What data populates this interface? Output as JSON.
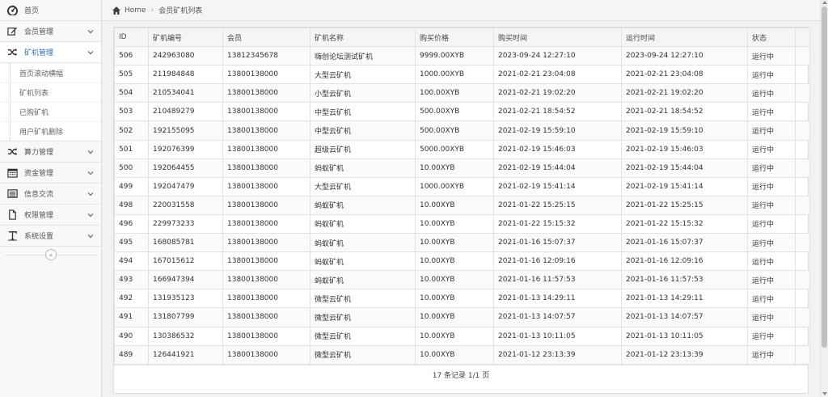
{
  "sidebar": {
    "items": [
      {
        "label": "首页",
        "icon": "dashboard-icon",
        "has_chevron": false
      },
      {
        "label": "会员管理",
        "icon": "edit-icon",
        "has_chevron": true
      },
      {
        "label": "矿机管理",
        "icon": "shuffle-icon",
        "has_chevron": true,
        "active": true,
        "sub": [
          {
            "label": "首页滚动横幅"
          },
          {
            "label": "矿机列表"
          },
          {
            "label": "已购矿机"
          },
          {
            "label": "用户矿机删除"
          }
        ]
      },
      {
        "label": "算力管理",
        "icon": "shuffle-icon",
        "has_chevron": true
      },
      {
        "label": "资金管理",
        "icon": "calendar-icon",
        "has_chevron": true
      },
      {
        "label": "信息交流",
        "icon": "list-icon",
        "has_chevron": true
      },
      {
        "label": "权限管理",
        "icon": "file-icon",
        "has_chevron": true
      },
      {
        "label": "系统设置",
        "icon": "text-icon",
        "has_chevron": true
      }
    ],
    "collapse_glyph": "«"
  },
  "breadcrumb": {
    "home": "Home",
    "separator": "›",
    "current": "会员矿机列表"
  },
  "table": {
    "columns": [
      "ID",
      "矿机编号",
      "会员",
      "矿机名称",
      "购买价格",
      "购买时间",
      "运行时间",
      "状态"
    ],
    "rows": [
      [
        "506",
        "242963080",
        "13812345678",
        "嗨创论坛测试矿机",
        "9999.00XYB",
        "2023-09-24 12:27:10",
        "2023-09-24 12:27:10",
        "运行中"
      ],
      [
        "505",
        "211984848",
        "13800138000",
        "大型云矿机",
        "1000.00XYB",
        "2021-02-21 23:04:08",
        "2021-02-21 23:04:08",
        "运行中"
      ],
      [
        "504",
        "210534041",
        "13800138000",
        "小型云矿机",
        "100.00XYB",
        "2021-02-21 19:02:20",
        "2021-02-21 19:02:20",
        "运行中"
      ],
      [
        "503",
        "210489279",
        "13800138000",
        "中型云矿机",
        "500.00XYB",
        "2021-02-21 18:54:52",
        "2021-02-21 18:54:52",
        "运行中"
      ],
      [
        "502",
        "192155095",
        "13800138000",
        "中型云矿机",
        "500.00XYB",
        "2021-02-19 15:59:10",
        "2021-02-19 15:59:10",
        "运行中"
      ],
      [
        "501",
        "192076399",
        "13800138000",
        "超级云矿机",
        "5000.00XYB",
        "2021-02-19 15:46:03",
        "2021-02-19 15:46:03",
        "运行中"
      ],
      [
        "500",
        "192064455",
        "13800138000",
        "蚂蚁矿机",
        "10.00XYB",
        "2021-02-19 15:44:04",
        "2021-02-19 15:44:04",
        "运行中"
      ],
      [
        "499",
        "192047479",
        "13800138000",
        "大型云矿机",
        "1000.00XYB",
        "2021-02-19 15:41:14",
        "2021-02-19 15:41:14",
        "运行中"
      ],
      [
        "498",
        "220031558",
        "13800138000",
        "蚂蚁矿机",
        "10.00XYB",
        "2021-01-22 15:25:15",
        "2021-01-22 15:25:15",
        "运行中"
      ],
      [
        "496",
        "229973233",
        "13800138000",
        "蚂蚁矿机",
        "10.00XYB",
        "2021-01-22 15:15:32",
        "2021-01-22 15:15:32",
        "运行中"
      ],
      [
        "495",
        "168085781",
        "13800138000",
        "蚂蚁矿机",
        "10.00XYB",
        "2021-01-16 15:07:37",
        "2021-01-16 15:07:37",
        "运行中"
      ],
      [
        "494",
        "167015612",
        "13800138000",
        "蚂蚁矿机",
        "10.00XYB",
        "2021-01-16 12:09:16",
        "2021-01-16 12:09:16",
        "运行中"
      ],
      [
        "493",
        "166947394",
        "13800138000",
        "蚂蚁矿机",
        "10.00XYB",
        "2021-01-16 11:57:53",
        "2021-01-16 11:57:53",
        "运行中"
      ],
      [
        "492",
        "131935123",
        "13800138000",
        "微型云矿机",
        "10.00XYB",
        "2021-01-13 14:29:11",
        "2021-01-13 14:29:11",
        "运行中"
      ],
      [
        "491",
        "131807799",
        "13800138000",
        "微型云矿机",
        "10.00XYB",
        "2021-01-13 14:07:57",
        "2021-01-13 14:07:57",
        "运行中"
      ],
      [
        "490",
        "130386532",
        "13800138000",
        "微型云矿机",
        "10.00XYB",
        "2021-01-13 10:11:05",
        "2021-01-13 10:11:05",
        "运行中"
      ],
      [
        "489",
        "126441921",
        "13800138000",
        "微型云矿机",
        "10.00XYB",
        "2021-01-12 23:13:39",
        "2021-01-12 23:13:39",
        "运行中"
      ]
    ],
    "footer": "17 条记录 1/1 页"
  }
}
